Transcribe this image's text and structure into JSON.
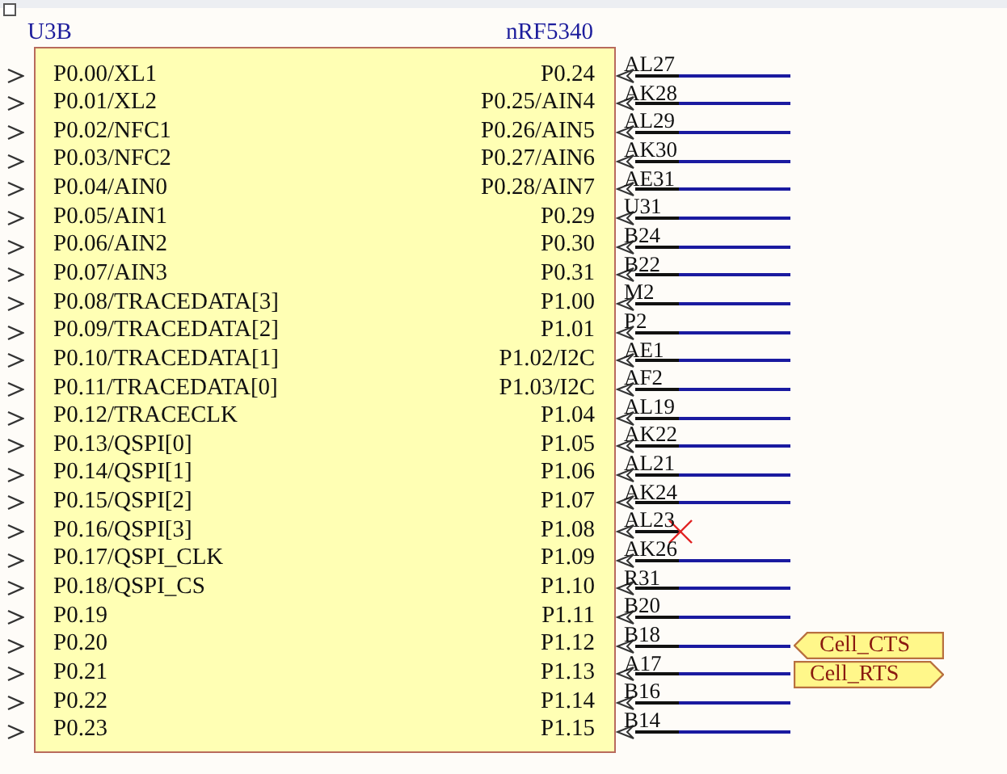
{
  "component": {
    "designator": "U3B",
    "part": "nRF5340",
    "left_pins": [
      {
        "name": "P0.00/XL1"
      },
      {
        "name": "P0.01/XL2"
      },
      {
        "name": "P0.02/NFC1"
      },
      {
        "name": "P0.03/NFC2"
      },
      {
        "name": "P0.04/AIN0"
      },
      {
        "name": "P0.05/AIN1"
      },
      {
        "name": "P0.06/AIN2"
      },
      {
        "name": "P0.07/AIN3"
      },
      {
        "name": "P0.08/TRACEDATA[3]"
      },
      {
        "name": "P0.09/TRACEDATA[2]"
      },
      {
        "name": "P0.10/TRACEDATA[1]"
      },
      {
        "name": "P0.11/TRACEDATA[0]"
      },
      {
        "name": "P0.12/TRACECLK"
      },
      {
        "name": "P0.13/QSPI[0]"
      },
      {
        "name": "P0.14/QSPI[1]"
      },
      {
        "name": "P0.15/QSPI[2]"
      },
      {
        "name": "P0.16/QSPI[3]"
      },
      {
        "name": "P0.17/QSPI_CLK"
      },
      {
        "name": "P0.18/QSPI_CS"
      },
      {
        "name": "P0.19"
      },
      {
        "name": "P0.20"
      },
      {
        "name": "P0.21"
      },
      {
        "name": "P0.22"
      },
      {
        "name": "P0.23"
      }
    ],
    "right_pins": [
      {
        "name": "P0.24",
        "number": "AL27",
        "no_connect": false
      },
      {
        "name": "P0.25/AIN4",
        "number": "AK28",
        "no_connect": false
      },
      {
        "name": "P0.26/AIN5",
        "number": "AL29",
        "no_connect": false
      },
      {
        "name": "P0.27/AIN6",
        "number": "AK30",
        "no_connect": false
      },
      {
        "name": "P0.28/AIN7",
        "number": "AE31",
        "no_connect": false
      },
      {
        "name": "P0.29",
        "number": "U31",
        "no_connect": false
      },
      {
        "name": "P0.30",
        "number": "B24",
        "no_connect": false
      },
      {
        "name": "P0.31",
        "number": "B22",
        "no_connect": false
      },
      {
        "name": "P1.00",
        "number": "M2",
        "no_connect": false
      },
      {
        "name": "P1.01",
        "number": "P2",
        "no_connect": false
      },
      {
        "name": "P1.02/I2C",
        "number": "AE1",
        "no_connect": false
      },
      {
        "name": "P1.03/I2C",
        "number": "AF2",
        "no_connect": false
      },
      {
        "name": "P1.04",
        "number": "AL19",
        "no_connect": false
      },
      {
        "name": "P1.05",
        "number": "AK22",
        "no_connect": false
      },
      {
        "name": "P1.06",
        "number": "AL21",
        "no_connect": false
      },
      {
        "name": "P1.07",
        "number": "AK24",
        "no_connect": false
      },
      {
        "name": "P1.08",
        "number": "AL23",
        "no_connect": true
      },
      {
        "name": "P1.09",
        "number": "AK26",
        "no_connect": false
      },
      {
        "name": "P1.10",
        "number": "R31",
        "no_connect": false
      },
      {
        "name": "P1.11",
        "number": "B20",
        "no_connect": false
      },
      {
        "name": "P1.12",
        "number": "B18",
        "no_connect": false,
        "net_label": {
          "text": "Cell_CTS",
          "kind": "input"
        }
      },
      {
        "name": "P1.13",
        "number": "A17",
        "no_connect": false,
        "net_label": {
          "text": "Cell_RTS",
          "kind": "output"
        }
      },
      {
        "name": "P1.14",
        "number": "B16",
        "no_connect": false
      },
      {
        "name": "P1.15",
        "number": "B14",
        "no_connect": false
      }
    ]
  }
}
